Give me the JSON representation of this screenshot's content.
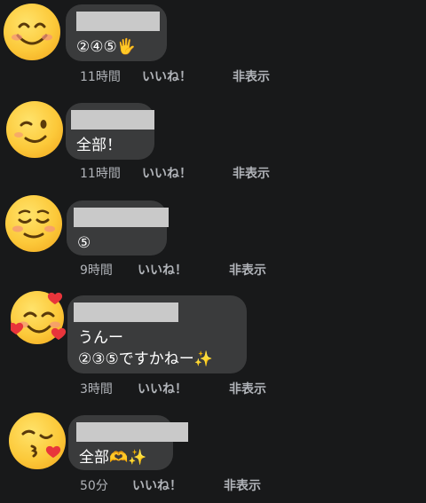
{
  "comments": [
    {
      "text": "②④⑤🖐",
      "time": "11時間",
      "like": "いいね！",
      "hide": "非表示",
      "avatar": "smiling-face-icon"
    },
    {
      "text": "全部！",
      "time": "11時間",
      "like": "いいね！",
      "hide": "非表示",
      "avatar": "winking-face-icon"
    },
    {
      "text": "⑤",
      "time": "9時間",
      "like": "いいね！",
      "hide": "非表示",
      "avatar": "relieved-face-icon"
    },
    {
      "text": "うんー\n②③⑤ですかねー✨",
      "time": "3時間",
      "like": "いいね！",
      "hide": "非表示",
      "avatar": "smiling-face-with-hearts-icon"
    },
    {
      "text": "全部🫶✨",
      "time": "50分",
      "like": "いいね！",
      "hide": "非表示",
      "avatar": "kissing-face-icon"
    }
  ],
  "colors": {
    "background": "#18191a",
    "bubble": "#3a3b3c",
    "meta_text": "#b0b3b8",
    "redaction": "#c9c9c9"
  }
}
